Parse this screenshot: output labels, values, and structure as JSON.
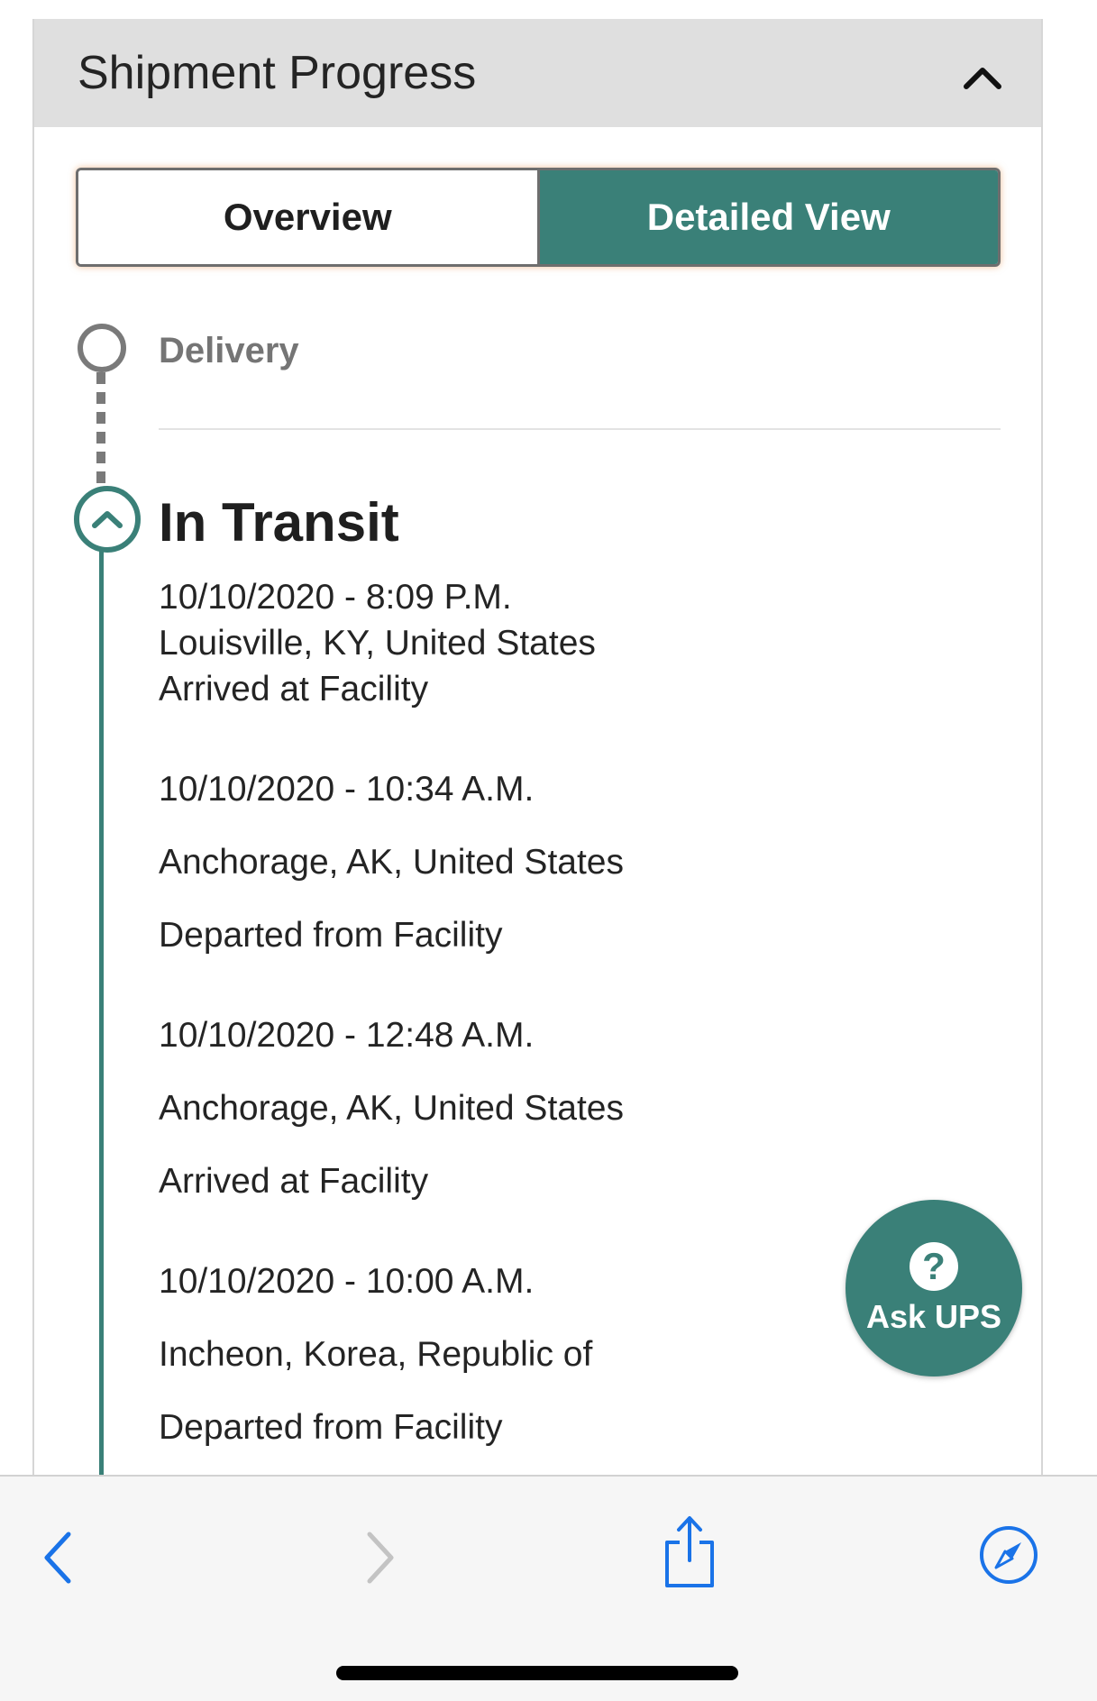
{
  "card": {
    "title": "Shipment Progress",
    "collapse_icon": "chevron-up-icon"
  },
  "view_toggle": {
    "overview_label": "Overview",
    "detailed_label": "Detailed View",
    "selected": "Detailed View"
  },
  "timeline": {
    "stages": [
      {
        "label": "Delivery",
        "state": "pending"
      },
      {
        "label": "In Transit",
        "state": "current-expanded"
      }
    ],
    "events": [
      {
        "datetime": "10/10/2020 - 8:09 P.M.",
        "location": "Louisville, KY, United States",
        "status": "Arrived at Facility"
      },
      {
        "datetime": "10/10/2020 - 10:34 A.M.",
        "location": "Anchorage, AK, United States",
        "status": "Departed from Facility"
      },
      {
        "datetime": "10/10/2020 - 12:48 A.M.",
        "location": "Anchorage, AK, United States",
        "status": "Arrived at Facility"
      },
      {
        "datetime": "10/10/2020 - 10:00 A.M.",
        "location": "Incheon, Korea, Republic of",
        "status": "Departed from Facility"
      }
    ]
  },
  "ask_button": {
    "label": "Ask UPS",
    "icon": "question-circle-icon"
  },
  "browser_toolbar": {
    "icons": [
      "back-icon",
      "forward-icon",
      "share-icon",
      "compass-icon"
    ]
  },
  "colors": {
    "accent": "#3a8078",
    "header_bg": "#dfdfdf",
    "ios_blue": "#1a73e8",
    "muted": "#757575"
  }
}
